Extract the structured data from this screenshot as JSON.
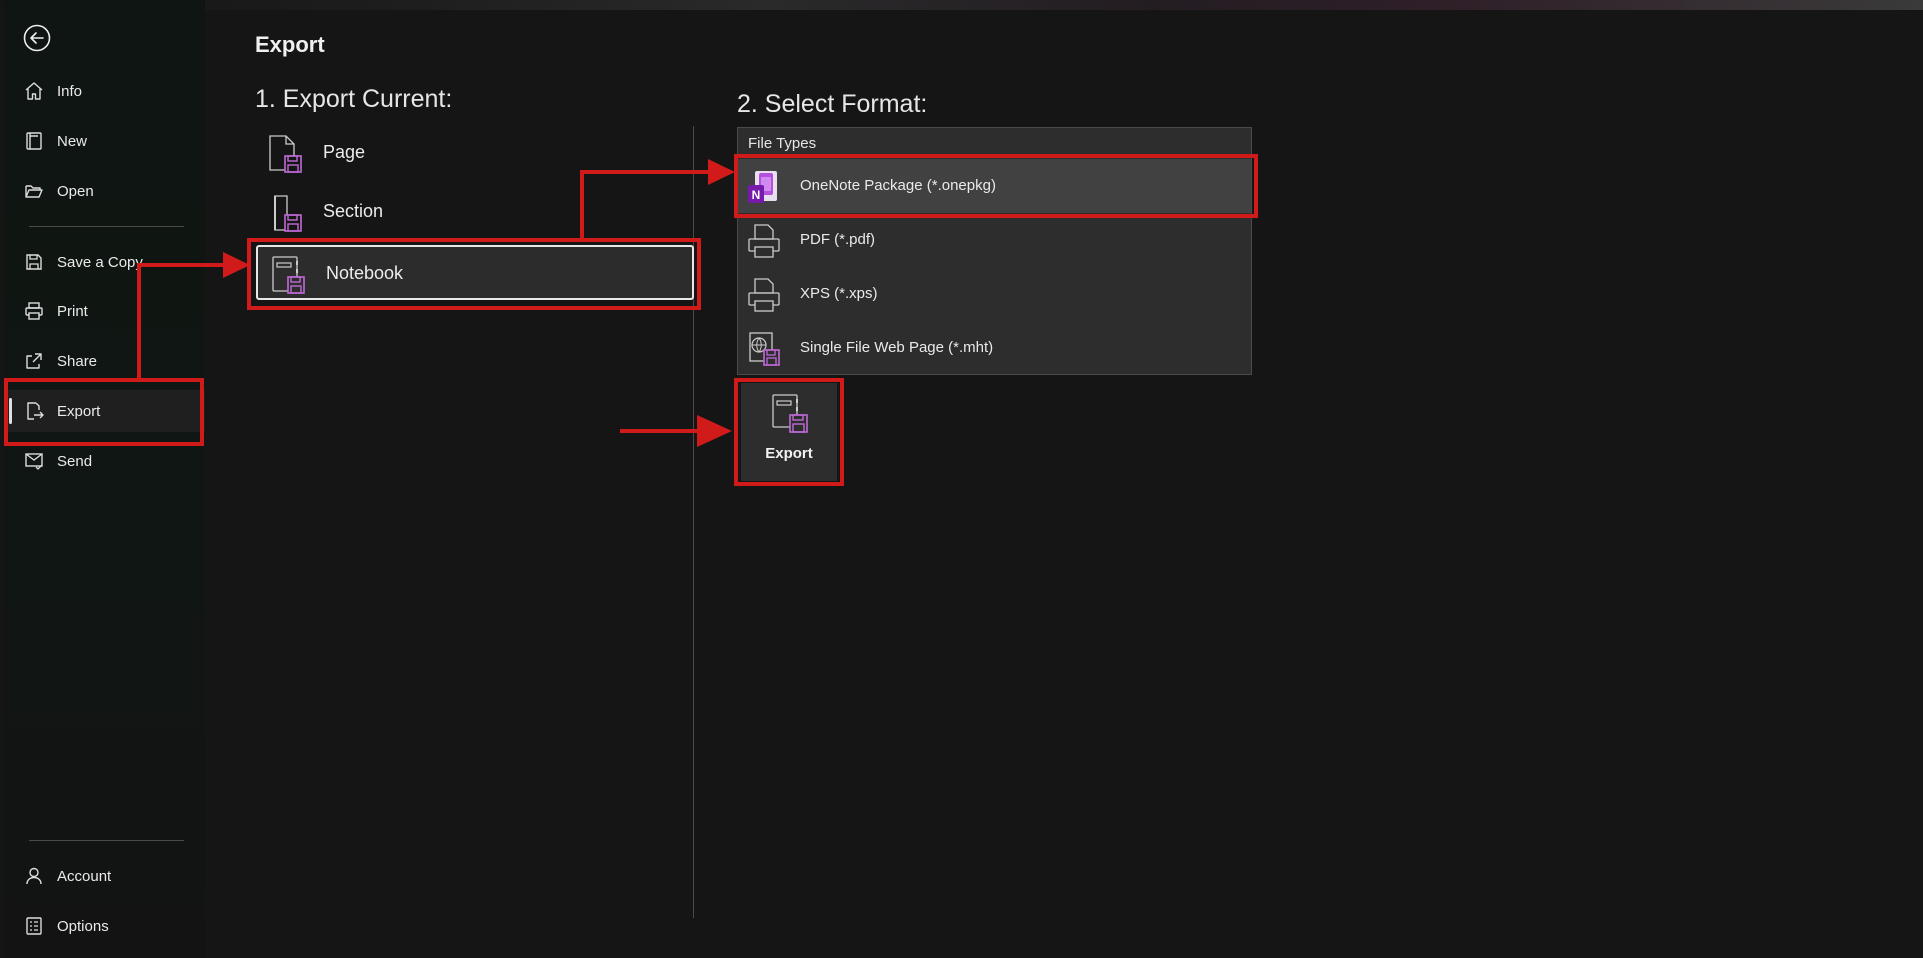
{
  "sidebar": {
    "back_icon": "back-arrow-icon",
    "items": [
      {
        "label": "Info",
        "icon": "home-icon"
      },
      {
        "label": "New",
        "icon": "new-notebook-icon"
      },
      {
        "label": "Open",
        "icon": "folder-open-icon"
      },
      {
        "label": "Save a Copy",
        "icon": "save-copy-icon"
      },
      {
        "label": "Print",
        "icon": "printer-icon"
      },
      {
        "label": "Share",
        "icon": "share-icon"
      },
      {
        "label": "Export",
        "icon": "export-icon",
        "active": true
      },
      {
        "label": "Send",
        "icon": "send-icon"
      }
    ],
    "bottom_items": [
      {
        "label": "Account",
        "icon": "person-icon"
      },
      {
        "label": "Options",
        "icon": "options-icon"
      }
    ]
  },
  "main": {
    "title": "Export",
    "export_current": {
      "heading": "1. Export Current:",
      "options": [
        {
          "label": "Page",
          "icon": "page-export-icon"
        },
        {
          "label": "Section",
          "icon": "section-export-icon"
        },
        {
          "label": "Notebook",
          "icon": "notebook-export-icon",
          "selected": true
        }
      ]
    },
    "select_format": {
      "heading": "2. Select Format:",
      "list_label": "File Types",
      "types": [
        {
          "label": "OneNote Package (*.onepkg)",
          "icon": "onenote-icon",
          "selected": true
        },
        {
          "label": "PDF (*.pdf)",
          "icon": "printer-icon"
        },
        {
          "label": "XPS (*.xps)",
          "icon": "printer-icon"
        },
        {
          "label": "Single File Web Page (*.mht)",
          "icon": "web-page-icon"
        }
      ]
    },
    "export_button": {
      "label": "Export",
      "icon": "export-notebook-icon"
    }
  },
  "colors": {
    "background": "#151515",
    "sidebar": "#101613",
    "annotation_red": "#d11a1a",
    "onenote_purple": "#7719aa",
    "save_accent": "#c06ad6"
  }
}
